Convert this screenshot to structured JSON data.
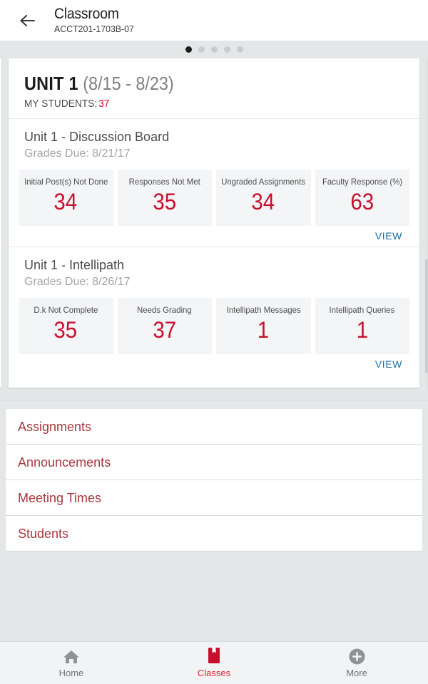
{
  "appbar": {
    "back_icon": "arrow-left-icon",
    "title": "Classroom",
    "subtitle": "ACCT201-1703B-07"
  },
  "carousel": {
    "dots_total": 5,
    "active_index": 0
  },
  "unit_card": {
    "unit_name": "UNIT 1",
    "date_range": "(8/15 - 8/23)",
    "students_label": "MY STUDENTS:",
    "students_count": "37",
    "sections": [
      {
        "title": "Unit 1 - Discussion Board",
        "subtitle": "Grades Due: 8/21/17",
        "view_label": "VIEW",
        "tiles": [
          {
            "label": "Initial Post(s) Not Done",
            "value": "34"
          },
          {
            "label": "Responses Not Met",
            "value": "35"
          },
          {
            "label": "Ungraded Assignments",
            "value": "34"
          },
          {
            "label": "Faculty Response (%)",
            "value": "63"
          }
        ]
      },
      {
        "title": "Unit 1 - Intellipath",
        "subtitle": "Grades Due: 8/26/17",
        "view_label": "VIEW",
        "tiles": [
          {
            "label": "D.k Not Complete",
            "value": "35"
          },
          {
            "label": "Needs Grading",
            "value": "37"
          },
          {
            "label": "Intellipath Messages",
            "value": "1"
          },
          {
            "label": "Intellipath Queries",
            "value": "1"
          }
        ]
      }
    ]
  },
  "menu": {
    "items": [
      {
        "label": "Assignments"
      },
      {
        "label": "Announcements"
      },
      {
        "label": "Meeting Times"
      },
      {
        "label": "Students"
      }
    ]
  },
  "bottomnav": {
    "items": [
      {
        "label": "Home",
        "icon": "home-icon",
        "active": false
      },
      {
        "label": "Classes",
        "icon": "book-icon",
        "active": true
      },
      {
        "label": "More",
        "icon": "plus-circle-icon",
        "active": false
      }
    ]
  },
  "colors": {
    "accent_red": "#c8102e",
    "menu_red": "#a8383e",
    "link_blue": "#1c6ea4",
    "page_bg": "#e4e7e8",
    "tile_bg": "#f4f5f6"
  }
}
